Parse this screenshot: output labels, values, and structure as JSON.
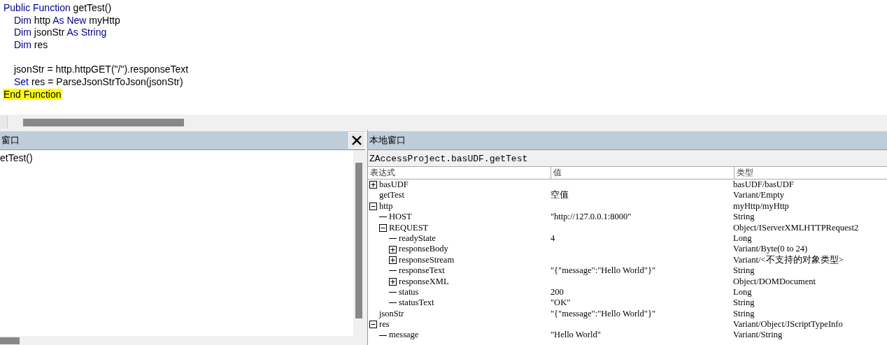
{
  "code_editor": {
    "lines": [
      {
        "highlighted": false,
        "tokens": [
          {
            "kind": "keyword",
            "text": "Public Function"
          },
          {
            "kind": "plain",
            "text": " getTest()"
          }
        ],
        "children": [
          {
            "highlighted": false,
            "tokens": [
              {
                "kind": "keyword",
                "text": "Dim"
              },
              {
                "kind": "plain",
                "text": " http "
              },
              {
                "kind": "keyword",
                "text": "As New"
              },
              {
                "kind": "plain",
                "text": " myHttp"
              }
            ]
          },
          {
            "highlighted": false,
            "tokens": [
              {
                "kind": "keyword",
                "text": "Dim"
              },
              {
                "kind": "plain",
                "text": " jsonStr "
              },
              {
                "kind": "keyword",
                "text": "As String"
              }
            ]
          },
          {
            "highlighted": false,
            "tokens": [
              {
                "kind": "keyword",
                "text": "Dim"
              },
              {
                "kind": "plain",
                "text": " res"
              }
            ]
          },
          {
            "highlighted": false
          },
          {
            "highlighted": false,
            "tokens": [
              {
                "kind": "plain",
                "text": "jsonStr = http.httpGET(\"/\").responseText"
              }
            ]
          },
          {
            "highlighted": false,
            "tokens": [
              {
                "kind": "keyword",
                "text": "Set"
              },
              {
                "kind": "plain",
                "text": " res = ParseJsonStrToJson(jsonStr)"
              }
            ]
          }
        ]
      },
      {
        "highlighted": true,
        "tokens": [
          {
            "kind": "plain",
            "text": "End Function"
          }
        ]
      }
    ]
  },
  "immediate_window": {
    "title": "窗口",
    "lines": [
      "etTest()"
    ]
  },
  "locals_window": {
    "title": "本地窗口",
    "context": "ZAccessProject.basUDF.getTest",
    "columns": [
      "表达式",
      "值",
      "类型"
    ],
    "rows": [
      {
        "name": "basUDF",
        "type": "basUDF/basUDF",
        "expanded": false
      },
      {
        "name": "getTest",
        "value": "空值",
        "type": "Variant/Empty"
      },
      {
        "name": "http",
        "type": "myHttp/myHttp",
        "expanded": true,
        "children": [
          {
            "name": "HOST",
            "value": "\"http://127.0.0.1:8000\"",
            "type": "String"
          },
          {
            "name": "REQUEST",
            "type": "Object/IServerXMLHTTPRequest2",
            "expanded": true,
            "children": [
              {
                "name": "readyState",
                "value": "4",
                "type": "Long"
              },
              {
                "name": "responseBody",
                "type": "Variant/Byte(0 to 24)",
                "expanded": false
              },
              {
                "name": "responseStream",
                "type": "Variant/<不支持的对象类型>",
                "expanded": false
              },
              {
                "name": "responseText",
                "value": "\"{\"message\":\"Hello World\"}\"",
                "type": "String"
              },
              {
                "name": "responseXML",
                "type": "Object/DOMDocument",
                "expanded": false
              },
              {
                "name": "status",
                "value": "200",
                "type": "Long"
              },
              {
                "name": "statusText",
                "value": "\"OK\"",
                "type": "String"
              }
            ]
          }
        ]
      },
      {
        "name": "jsonStr",
        "value": "\"{\"message\":\"Hello World\"}\"",
        "type": "String"
      },
      {
        "name": "res",
        "type": "Variant/Object/JScriptTypeInfo",
        "expanded": true,
        "children": [
          {
            "name": "message",
            "value": "\"Hello World\"",
            "type": "Variant/String"
          }
        ]
      }
    ]
  }
}
